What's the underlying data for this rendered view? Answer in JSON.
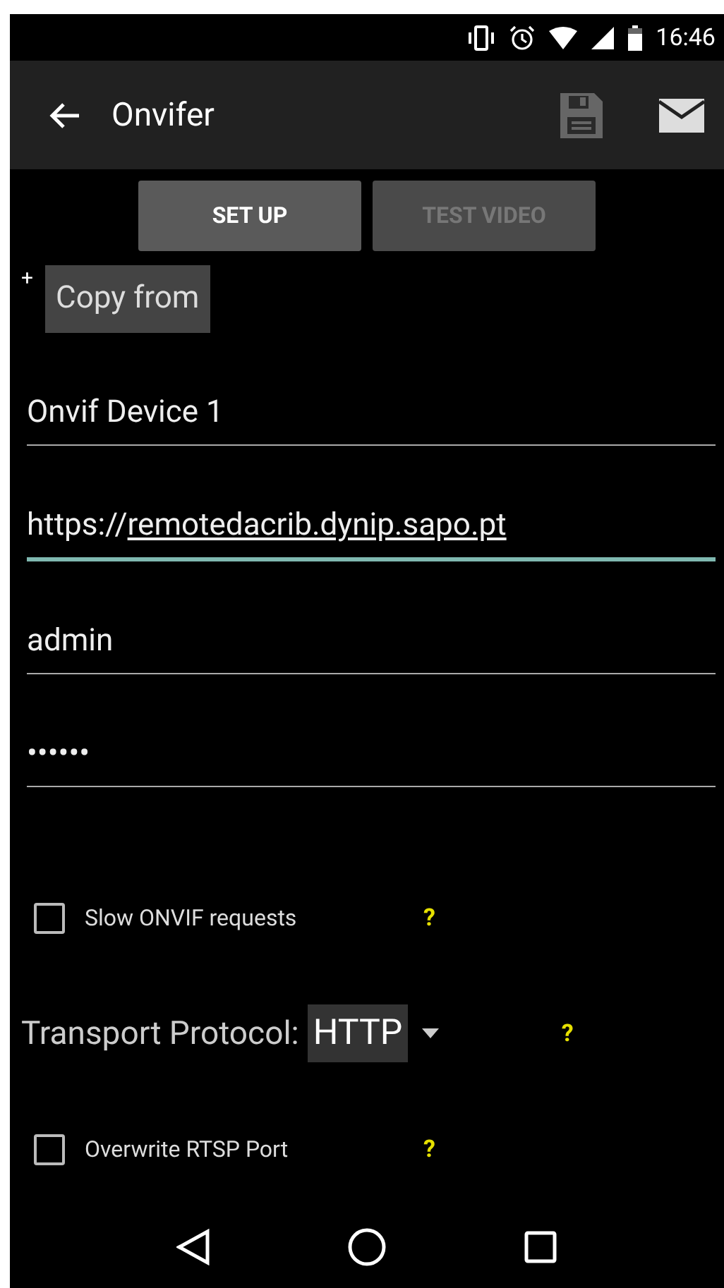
{
  "status_bar": {
    "time": "16:46"
  },
  "app_bar": {
    "title": "Onvifer"
  },
  "buttons": [
    {
      "label": "SET UP",
      "disabled": false
    },
    {
      "label": "TEST VIDEO",
      "disabled": true
    }
  ],
  "copy_from": {
    "plus": "+",
    "label": "Copy from"
  },
  "fields": [
    {
      "value": "Onvif Device 1",
      "focused": false
    },
    {
      "value": "https://",
      "link": "remotedacrib.dynip.sapo.pt",
      "focused": true
    },
    {
      "value": "admin",
      "focused": false
    },
    {
      "value": "••••••",
      "focused": false
    }
  ],
  "options": [
    {
      "kind": "checkbox",
      "label": "Slow ONVIF requests",
      "checked": false,
      "help": "?"
    },
    {
      "kind": "select",
      "label": "Transport Protocol:",
      "value": "HTTP",
      "help": "?"
    },
    {
      "kind": "checkbox",
      "label": "Overwrite RTSP Port",
      "checked": false,
      "help": "?"
    }
  ]
}
